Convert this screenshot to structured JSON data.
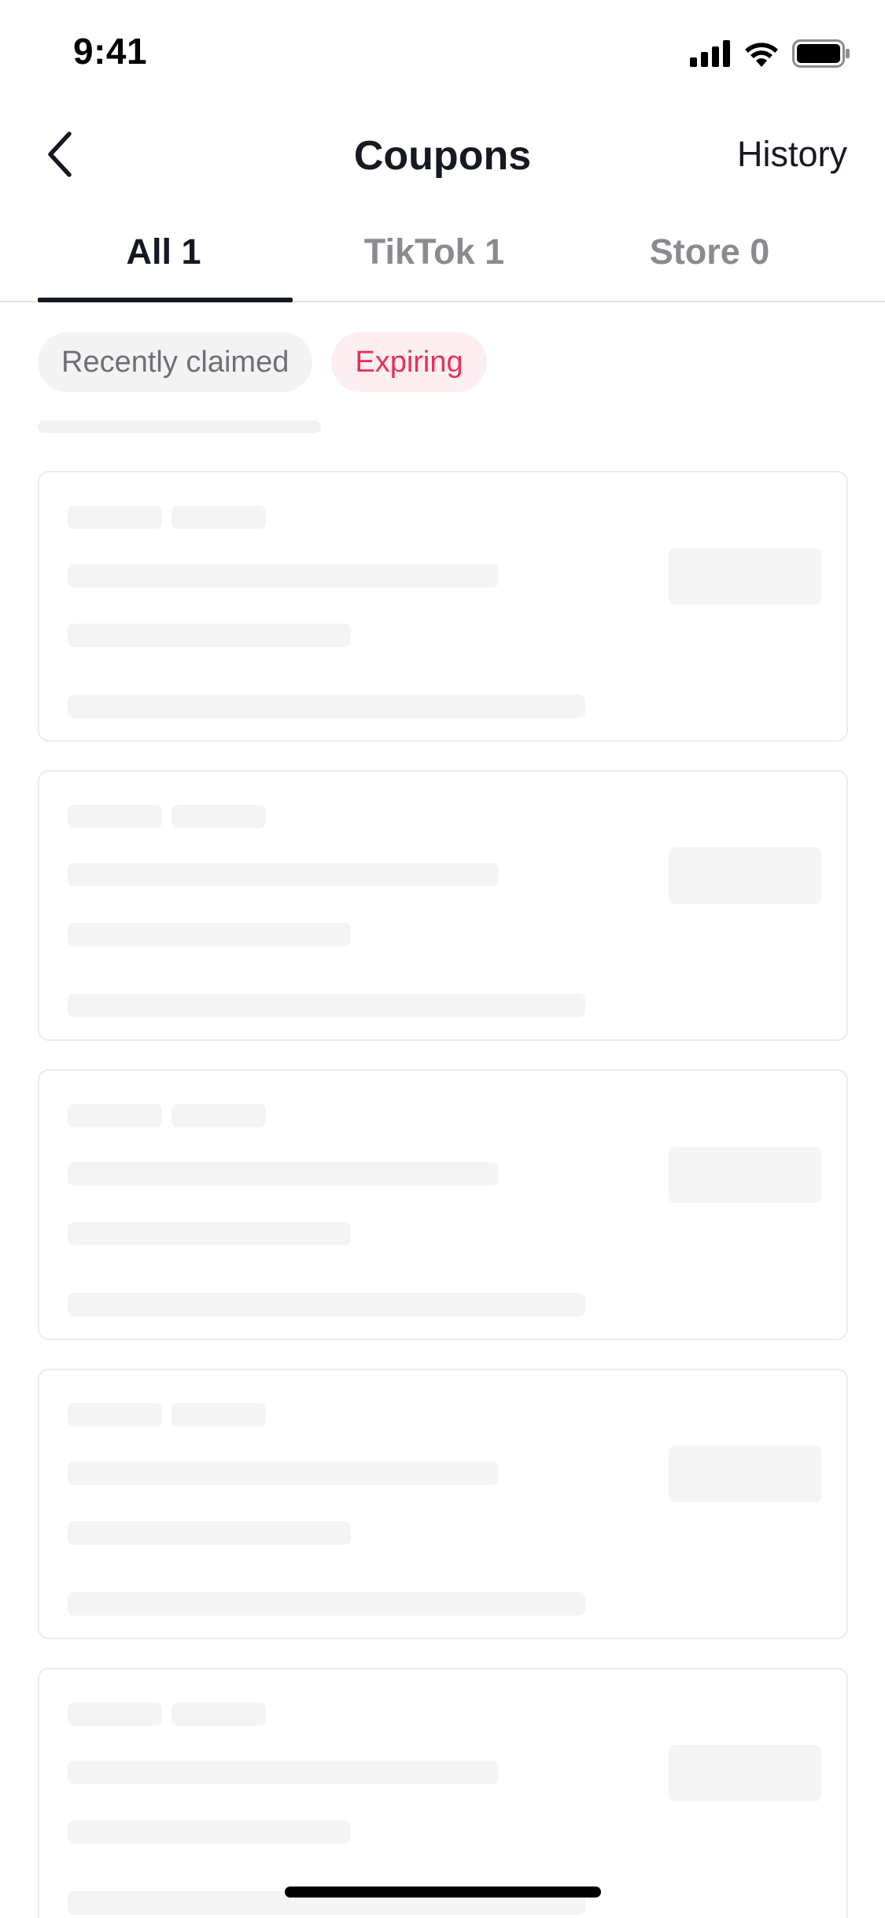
{
  "status_bar": {
    "time": "9:41",
    "icons": [
      "signal-icon",
      "wifi-icon",
      "battery-icon"
    ]
  },
  "nav": {
    "back_icon": "chevron-left-icon",
    "title": "Coupons",
    "history_label": "History"
  },
  "tabs": [
    {
      "label": "All 1",
      "active": true
    },
    {
      "label": "TikTok 1",
      "active": false
    },
    {
      "label": "Store 0",
      "active": false
    }
  ],
  "filters": [
    {
      "label": "Recently claimed",
      "active": false
    },
    {
      "label": "Expiring",
      "active": true
    }
  ],
  "colors": {
    "text_primary": "#161823",
    "text_secondary": "#8a8b91",
    "accent": "#e8315a",
    "accent_bg": "#fdeef1",
    "skeleton": "#f4f4f4"
  },
  "placeholder_cards": 5
}
